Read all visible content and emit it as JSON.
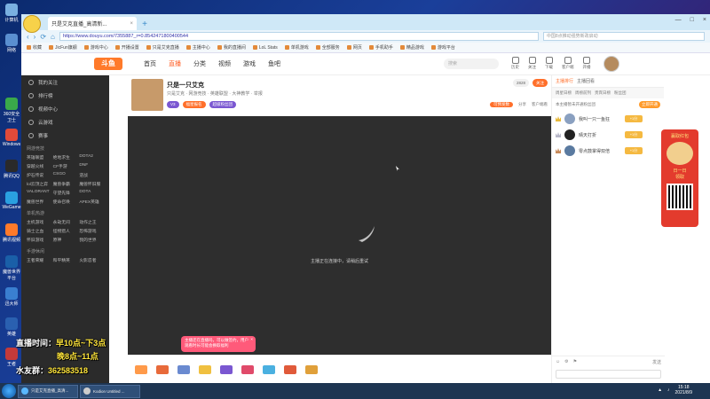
{
  "desktop": {
    "icons": [
      "计算机",
      "网络",
      "360安全卫士",
      "Windows",
      "腾讯QQ",
      "WeGame",
      "腾讯视频",
      "魔兽世界平台",
      "迅大师",
      "英雄",
      "王者"
    ]
  },
  "browser": {
    "tab_title": "只是艾克直播_高清新...",
    "url": "https://www.douyu.com/7355887_r=0.8542471800400544",
    "search_placeholder": "中国8点推动强势新政启动",
    "bookmarks": [
      "收藏",
      "JicFun旗舰",
      "游戏中心",
      "开播设置",
      "只是艾克直播",
      "主播中心",
      "我的直播间",
      "LoL Stats",
      "单机游戏",
      "全部服务",
      "网页",
      "手机助手",
      "精品游戏",
      "游戏平台"
    ]
  },
  "site": {
    "logo": "斗鱼",
    "nav": [
      "首页",
      "直播",
      "分类",
      "视频",
      "游戏",
      "鱼吧"
    ],
    "search_placeholder": "搜索",
    "header_icons": [
      "历史",
      "关注",
      "下载",
      "客户端",
      "开播"
    ]
  },
  "sidebar": {
    "top_items": [
      "我的关注",
      "排行榜",
      "视频中心",
      "云游戏",
      "赛事"
    ],
    "sections": [
      {
        "title": "网游竞技",
        "items": [
          "英雄联盟",
          "绝地求生",
          "DOTA2",
          "穿越火线",
          "CF手游",
          "DNF",
          "炉石传说",
          "CSGO",
          "逆战",
          "lol云顶之弈",
          "魔兽争霸",
          "魔兽怀旧服",
          "VALORANT",
          "守望先锋",
          "DOTA",
          "魔兽世界",
          "使命召唤",
          "APEX英雄"
        ]
      },
      {
        "title": "单机热游",
        "items": [
          "主机游戏",
          "永劫无间",
          "动作之王",
          "骑士之血",
          "怪物猎人",
          "恐怖游戏",
          "怀旧游戏",
          "原神",
          "我的世界"
        ]
      },
      {
        "title": "手游休闲",
        "items": [
          "王者荣耀",
          "和平精英",
          "火影忍者"
        ]
      }
    ]
  },
  "room": {
    "title": "只是一只艾克",
    "category": "英雄联盟",
    "meta": "网游竞技 · 英雄联盟 · 大神教学",
    "level_badge": "只是艾克",
    "report": "举报",
    "followers": "2828",
    "follow_button": "关注",
    "badges": [
      "V3",
      "福星报名",
      "超级粉丝团"
    ],
    "tools": [
      "可预发数",
      "分享",
      "客户端看"
    ],
    "loading_text": "主播正在连接中，请稍后重试",
    "toast": "主播还在直播吗，可以做签约，用户观看时长可能会换取福利"
  },
  "panel": {
    "tabs": [
      "主播排行",
      "主播回看"
    ],
    "sub_tabs": [
      "周星日榜",
      "周榜前列",
      "贵宾日榜",
      "粉丝团"
    ],
    "notice": "本主播暂未开通粉丝团",
    "notice_button": "立即开通",
    "ranks": [
      {
        "name": "我叫一只一鱼狂",
        "tag": "+1分"
      },
      {
        "name": "晴天打折",
        "tag": "+1分"
      },
      {
        "name": "零点鼓掌得双倍",
        "tag": "+1分"
      }
    ],
    "chat_send": "发送"
  },
  "promo": {
    "title": "赢取红包",
    "subtitle": "日一日",
    "cta": "领取"
  },
  "overlay": {
    "line1_label": "直播时间：",
    "line1_value": "早10点~下3点",
    "line2_value": "晚8点~11点",
    "line3_label": "水友群：",
    "line3_value": "362583518"
  },
  "taskbar": {
    "items": [
      "只是艾克直播_高清...",
      "Kodion Untitled ..."
    ],
    "time": "15:18",
    "date": "2021/8/9"
  }
}
